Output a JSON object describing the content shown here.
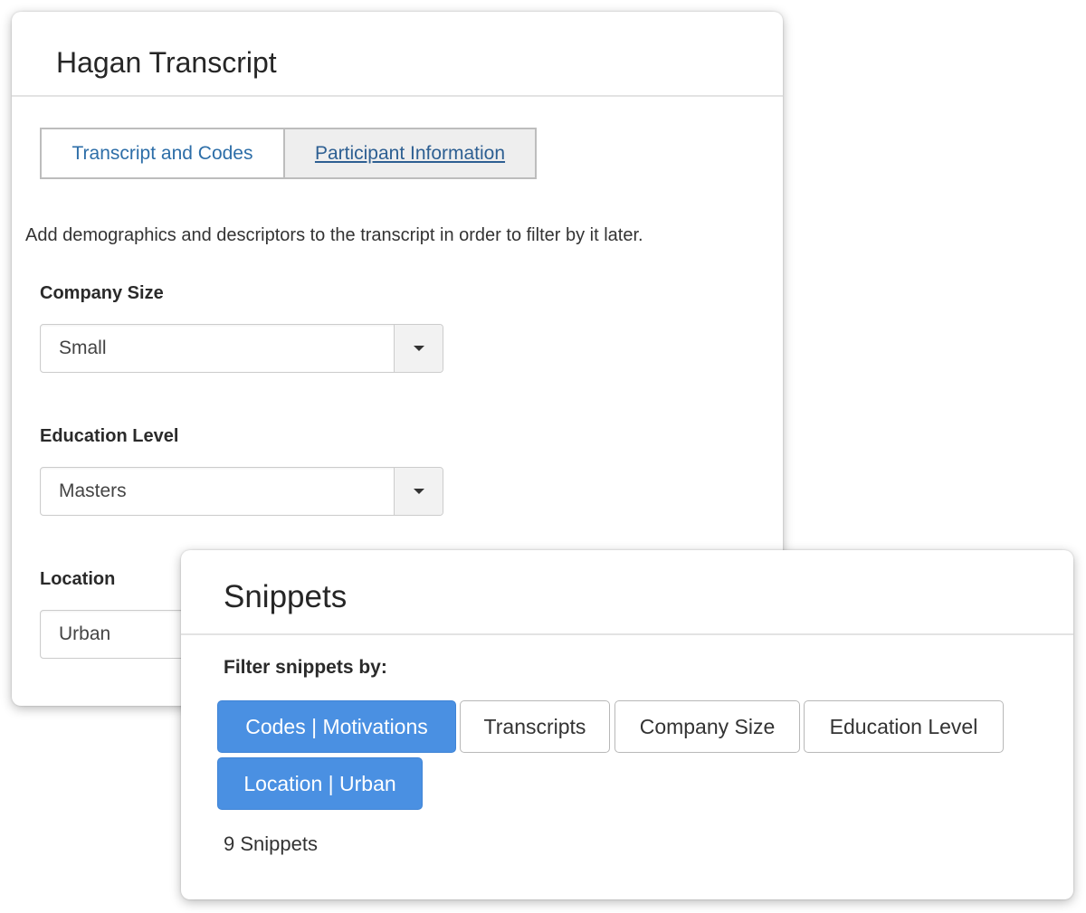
{
  "transcript_panel": {
    "title": "Hagan Transcript",
    "tabs": [
      {
        "label": "Transcript and Codes",
        "active": true
      },
      {
        "label": "Participant Information",
        "active": false
      }
    ],
    "description": "Add demographics and descriptors to the transcript in order to filter by it later.",
    "fields": [
      {
        "label": "Company Size",
        "value": "Small"
      },
      {
        "label": "Education Level",
        "value": "Masters"
      },
      {
        "label": "Location",
        "value": "Urban"
      }
    ]
  },
  "snippets_panel": {
    "title": "Snippets",
    "filter_label": "Filter snippets by:",
    "filters": [
      {
        "label": "Codes | Motivations",
        "active": true
      },
      {
        "label": "Transcripts",
        "active": false
      },
      {
        "label": "Company Size",
        "active": false
      },
      {
        "label": "Education Level",
        "active": false
      },
      {
        "label": "Location | Urban",
        "active": true
      }
    ],
    "count_text": "9 Snippets"
  },
  "colors": {
    "accent": "#4a90e2",
    "link": "#2d6ea8",
    "inactive_tab_bg": "#eeeeee"
  },
  "icons": {
    "dropdown": "caret-down-icon"
  }
}
